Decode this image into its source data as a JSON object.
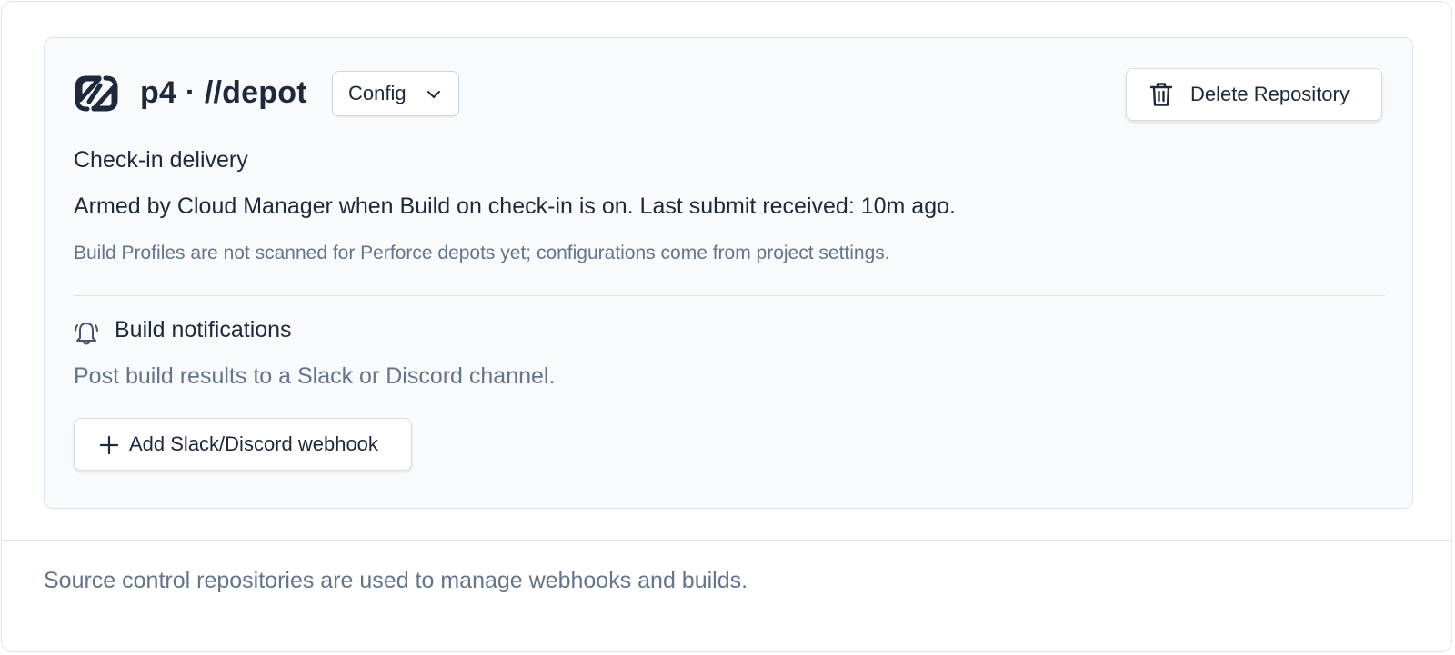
{
  "repository": {
    "title": "p4 · //depot",
    "icon": "link-icon",
    "config_label": "Config",
    "config_icon": "chevron-down-icon",
    "delete_label": "Delete Repository",
    "delete_icon": "trash-icon"
  },
  "delivery": {
    "label": "Check-in delivery",
    "status": "Armed by Cloud Manager when Build on check-in is on. Last submit received: 10m ago.",
    "hint": "Build Profiles are not scanned for Perforce depots yet; configurations come from project settings."
  },
  "notifications": {
    "icon": "bell-icon",
    "title": "Build notifications",
    "description": "Post build results to a Slack or Discord channel.",
    "add_label": "Add Slack/Discord webhook",
    "add_icon": "plus-icon"
  },
  "footer": {
    "text": "Source control repositories are used to manage webhooks and builds."
  },
  "colors": {
    "card_background": "#f8fafc",
    "text_primary": "#1e293b",
    "text_muted": "#64748b",
    "border": "#dde3ea"
  }
}
